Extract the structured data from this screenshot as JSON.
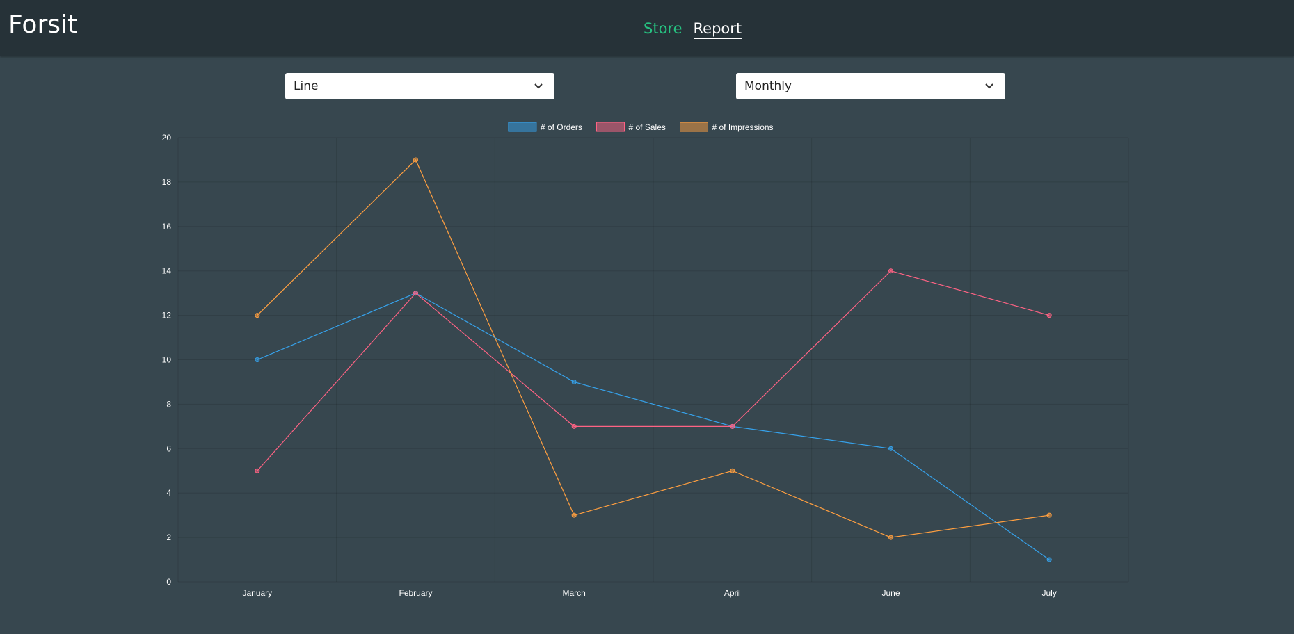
{
  "brand": "Forsit",
  "nav": {
    "store": "Store",
    "report": "Report"
  },
  "controls": {
    "chart_type": "Line",
    "period": "Monthly"
  },
  "icons": {
    "dropdown": "chevron-down-icon"
  },
  "colors": {
    "orders": "#36a2eb",
    "sales": "#ff6384",
    "impressions": "#ff9f40",
    "accent_nav": "#26c281"
  },
  "chart_data": {
    "type": "line",
    "categories": [
      "January",
      "February",
      "March",
      "April",
      "June",
      "July"
    ],
    "ylim": [
      0,
      20
    ],
    "yticks": [
      0,
      2,
      4,
      6,
      8,
      10,
      12,
      14,
      16,
      18,
      20
    ],
    "grid": true,
    "legend_position": "top-center",
    "series": [
      {
        "name": "# of Orders",
        "color": "#36a2eb",
        "values": [
          10,
          13,
          9,
          7,
          6,
          1
        ]
      },
      {
        "name": "# of Sales",
        "color": "#ff6384",
        "values": [
          5,
          13,
          7,
          7,
          14,
          12
        ]
      },
      {
        "name": "# of Impressions",
        "color": "#ff9f40",
        "values": [
          12,
          19,
          3,
          5,
          2,
          3
        ]
      }
    ]
  }
}
